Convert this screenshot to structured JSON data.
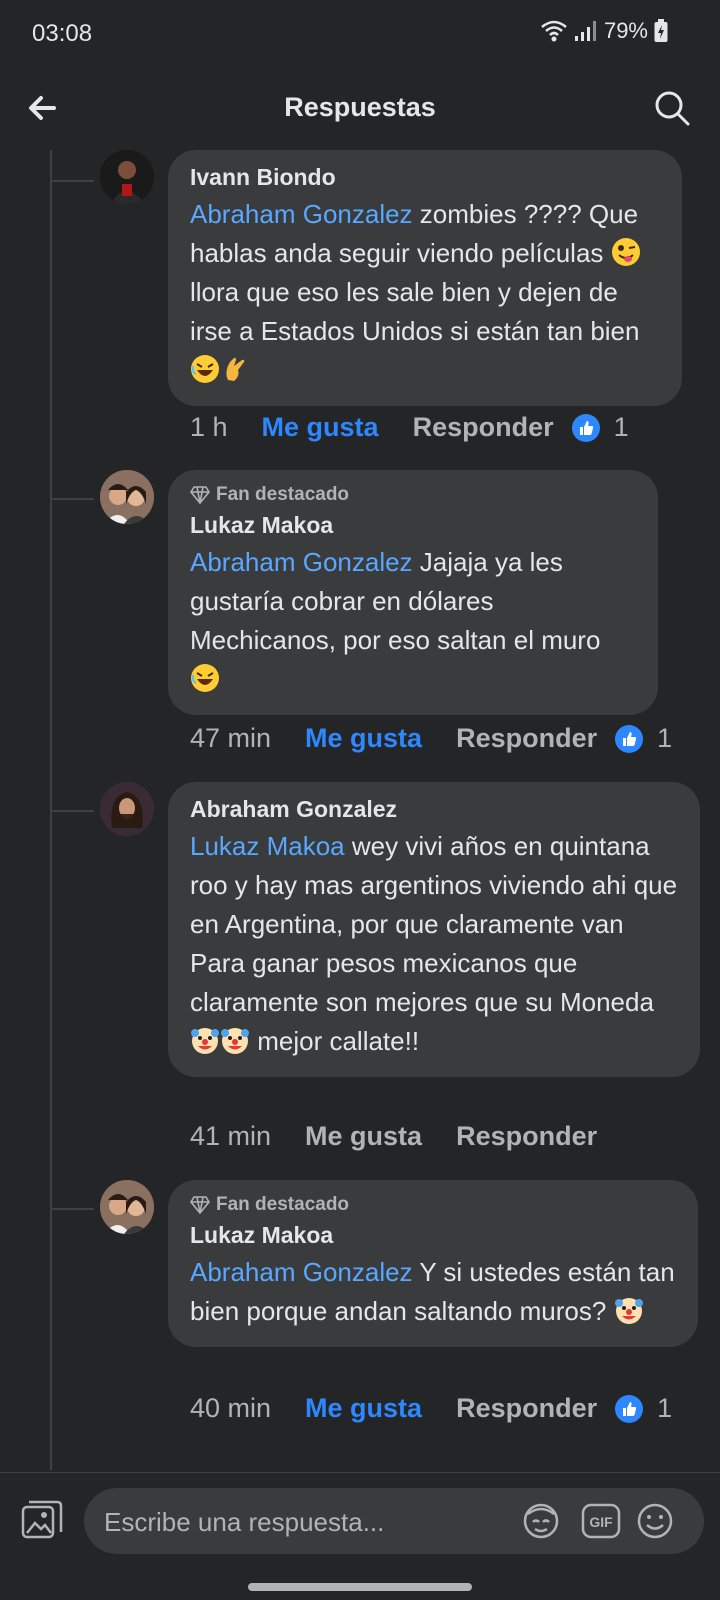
{
  "status_bar": {
    "time": "03:08",
    "battery": "79%"
  },
  "header": {
    "title": "Respuestas"
  },
  "comments": [
    {
      "author": "Ivann Biondo",
      "badge": "",
      "mention": "Abraham Gonzalez",
      "text_1": " zombies ???? Que hablas anda seguir viendo películas ",
      "text_2": " llora que eso les sale bien y dejen de irse a Estados Unidos si están tan bien ",
      "time": "1 h",
      "like_label": "Me gusta",
      "reply_label": "Responder",
      "reaction_count": "1"
    },
    {
      "author": "Lukaz Makoa",
      "badge": "Fan destacado",
      "mention": "Abraham Gonzalez",
      "text_1": " Jajaja ya les gustaría cobrar en dólares Mechicanos, por eso saltan el muro ",
      "time": "47 min",
      "like_label": "Me gusta",
      "reply_label": "Responder",
      "reaction_count": "1"
    },
    {
      "author": "Abraham Gonzalez",
      "badge": "",
      "mention": "Lukaz Makoa",
      "text_1": " wey vivi años en quintana roo y hay mas argentinos viviendo ahi que en Argentina, por que claramente van Para ganar pesos mexicanos que claramente son mejores que su Moneda ",
      "text_2": " mejor callate!!",
      "time": "41 min",
      "like_label": "Me gusta",
      "reply_label": "Responder"
    },
    {
      "author": "Lukaz Makoa",
      "badge": "Fan destacado",
      "mention": "Abraham Gonzalez",
      "text_1": " Y si ustedes están tan bien porque andan saltando muros? ",
      "time": "40 min",
      "like_label": "Me gusta",
      "reply_label": "Responder",
      "reaction_count": "1"
    }
  ],
  "composer": {
    "placeholder": "Escribe una respuesta..."
  },
  "colors": {
    "background": "#242526",
    "bubble": "#3a3b3c",
    "accent": "#2d88ff",
    "mention": "#5aa7ff"
  }
}
